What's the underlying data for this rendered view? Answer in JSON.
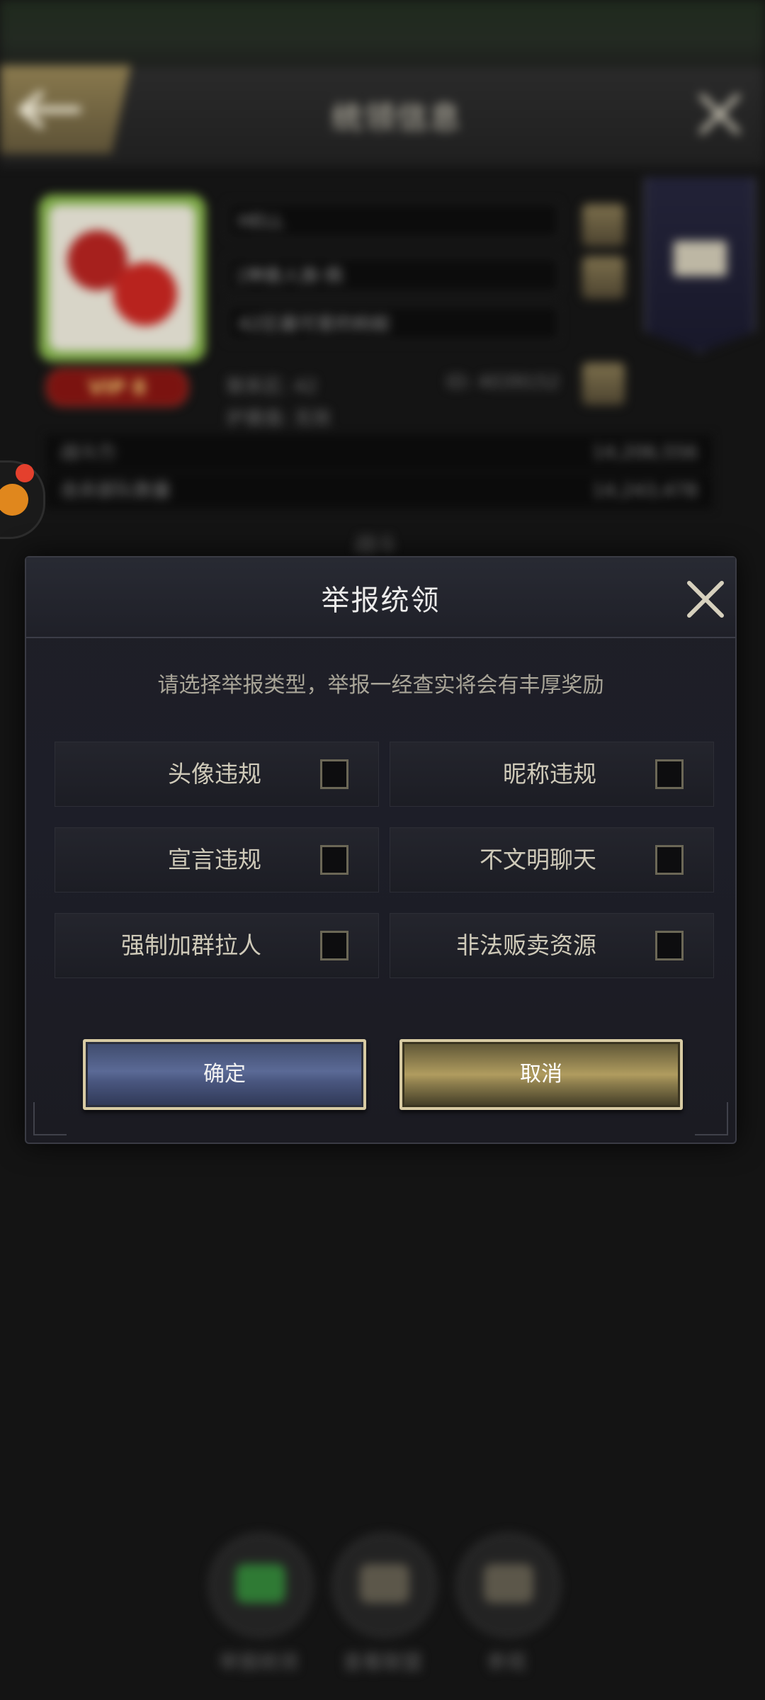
{
  "background": {
    "header_title": "统领信息",
    "player_name": "HELL",
    "alliance": "[神兽人族·佩",
    "declaration": "42区最可爱的蚂蚁",
    "meta_left": "联系区: 42",
    "meta_right": "ID: 4039152",
    "meta_second": "护盾值: 无效",
    "vip": "VIP 8",
    "stats": [
      {
        "label": "战斗力",
        "value": "14,206,556"
      },
      {
        "label": "击杀部队数量",
        "value": "14,243,478"
      }
    ],
    "section_label": "战斗",
    "dock": [
      {
        "label": "举报统领"
      },
      {
        "label": "查看联盟"
      },
      {
        "label": "参观"
      }
    ]
  },
  "dialog": {
    "title": "举报统领",
    "description": "请选择举报类型，举报一经查实将会有丰厚奖励",
    "options": [
      {
        "label": "头像违规",
        "checked": false
      },
      {
        "label": "昵称违规",
        "checked": false
      },
      {
        "label": "宣言违规",
        "checked": false
      },
      {
        "label": "不文明聊天",
        "checked": false
      },
      {
        "label": "强制加群拉人",
        "checked": false
      },
      {
        "label": "非法贩卖资源",
        "checked": false
      }
    ],
    "confirm_label": "确定",
    "cancel_label": "取消"
  },
  "colors": {
    "accent_gold": "#d8cba3",
    "confirm_blue": "#5b6a96",
    "cancel_gold": "#b09c5f"
  }
}
